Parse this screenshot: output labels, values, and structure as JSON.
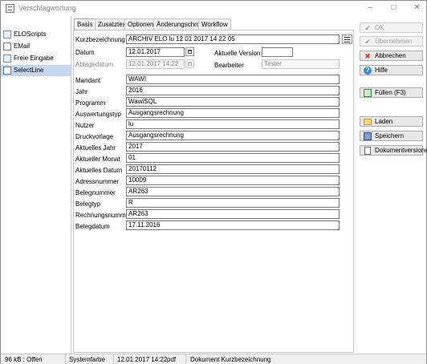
{
  "window": {
    "title": "Verschlagwortung",
    "controls": {
      "minimize": "–",
      "maximize": "□",
      "close": "✕"
    }
  },
  "sidebar": {
    "items": [
      {
        "label": "ELOScripts",
        "icon": "script-icon",
        "selected": false
      },
      {
        "label": "EMail",
        "icon": "mail-icon",
        "selected": false
      },
      {
        "label": "Freie Eingabe",
        "icon": "edit-icon",
        "selected": false
      },
      {
        "label": "SelectLine",
        "icon": "selectline-icon",
        "selected": true
      }
    ]
  },
  "tabs": [
    {
      "label": "Basis",
      "active": true
    },
    {
      "label": "Zusatztext",
      "active": false
    },
    {
      "label": "Optionen",
      "active": false
    },
    {
      "label": "Änderungschronik",
      "active": false
    },
    {
      "label": "Workflow",
      "active": false
    }
  ],
  "basis": {
    "kurzbezeichnung": {
      "label": "Kurzbezeichnung",
      "value": "ARCHIV ELO lu 12 01 2017 14 22 05"
    },
    "datum": {
      "label": "Datum",
      "value": "12.01.2017"
    },
    "aktuelle_version": {
      "label": "Aktuelle Version",
      "value": ""
    },
    "ablagedatum": {
      "label": "Ablagedatum",
      "value": "12.01.2017 14:22"
    },
    "bearbeiter": {
      "label": "Bearbeiter",
      "value": "Tester"
    }
  },
  "index_fields": [
    {
      "label": "Mandant",
      "value": "WAWI"
    },
    {
      "label": "Jahr",
      "value": "2016"
    },
    {
      "label": "Programm",
      "value": "WawiSQL"
    },
    {
      "label": "Auswertungstyp",
      "value": "Ausgangsrechnung"
    },
    {
      "label": "Nutzer",
      "value": "lu"
    },
    {
      "label": "Druckvorlage",
      "value": "Ausgangsrechnung"
    },
    {
      "label": "Aktuelles Jahr",
      "value": "2017"
    },
    {
      "label": "Aktueller Monat",
      "value": "01"
    },
    {
      "label": "Aktuelles Datum",
      "value": "20170112"
    },
    {
      "label": "Adressnummer",
      "value": "10009"
    },
    {
      "label": "Belegnummer",
      "value": "AR263"
    },
    {
      "label": "Belegtyp",
      "value": "R"
    },
    {
      "label": "Rechnungsnummer",
      "value": "AR263"
    },
    {
      "label": "Belegdatum",
      "value": "17.11.2016"
    }
  ],
  "buttons": {
    "ok": {
      "label": "OK",
      "enabled": false
    },
    "uebernehmen": {
      "label": "Übernehmen",
      "enabled": false
    },
    "abbrechen": {
      "label": "Abbrechen",
      "enabled": true
    },
    "hilfe": {
      "label": "Hilfe",
      "enabled": true
    },
    "fuellen": {
      "label": "Füllen (F3)",
      "enabled": true
    },
    "laden": {
      "label": "Laden",
      "enabled": true
    },
    "speichern": {
      "label": "Speichern",
      "enabled": true
    },
    "dokumentversionen": {
      "label": "Dokumentversionen",
      "enabled": true
    }
  },
  "statusbar": {
    "size_status": "96 kB : Offen",
    "color": "Systemfarbe",
    "datetime": "12.01.2017 14:22",
    "filetype": "pdf",
    "document": "Dokument Kurzbezeichnung"
  }
}
